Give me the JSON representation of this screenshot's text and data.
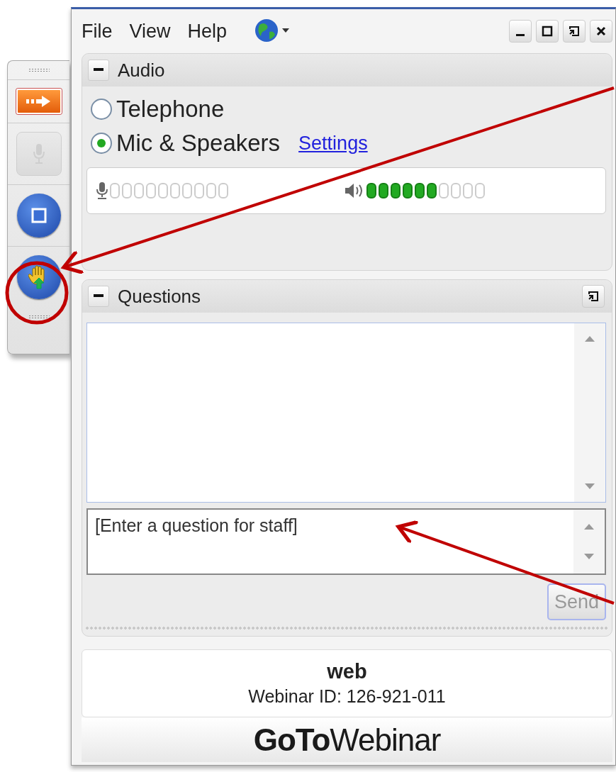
{
  "menu": [
    {
      "label": "File"
    },
    {
      "label": "View"
    },
    {
      "label": "Help"
    }
  ],
  "toolbar": [
    {
      "kind": "show",
      "disabled": false
    },
    {
      "kind": "mic",
      "disabled": true
    },
    {
      "kind": "screen",
      "disabled": false
    },
    {
      "kind": "hand",
      "disabled": false
    }
  ],
  "audio": {
    "title": "Audio",
    "options": [
      {
        "label": "Telephone",
        "selected": false
      },
      {
        "label": "Mic & Speakers",
        "selected": true
      }
    ],
    "settings_link": "Settings",
    "meters": [
      {
        "kind": "microphone"
      },
      {
        "kind": "speaker",
        "level": 0.6
      }
    ]
  },
  "questions": {
    "title": "Questions",
    "input": {
      "placeholder": "[Enter a question for staff]"
    },
    "send": {
      "label": "Send",
      "disabled": true
    }
  },
  "info": {
    "title": "web",
    "webinar_id": "Webinar ID: 126-921-011"
  },
  "brand": "**GoTo**Webinar"
}
